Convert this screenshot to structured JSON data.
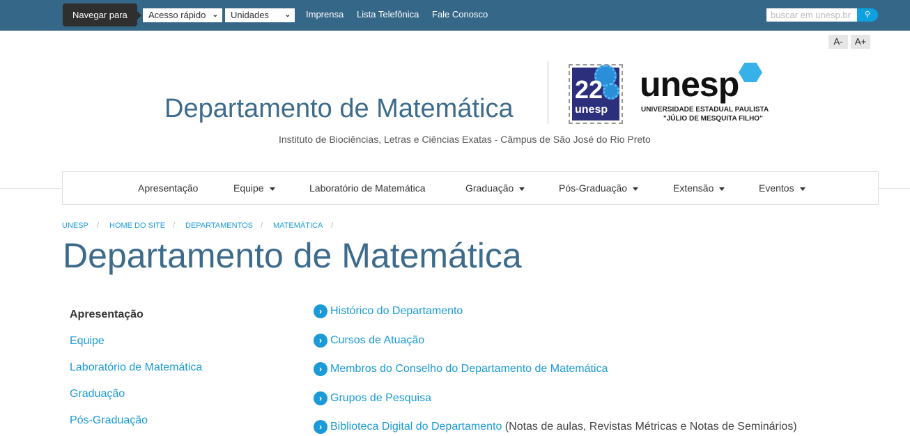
{
  "topbar": {
    "nav_for": "Navegar para",
    "quick_access": "Acesso rápido",
    "units": "Unidades",
    "links": [
      "Imprensa",
      "Lista Telefônica",
      "Fale Conosco"
    ],
    "search_placeholder": "buscar em unesp.br"
  },
  "font_controls": {
    "decrease": "A-",
    "increase": "A+"
  },
  "header": {
    "title": "Departamento de Matemática",
    "subtitle": "Instituto de Biociências, Letras e Ciências Exatas - Câmpus de São José do Rio Preto",
    "stamp_text": [
      "22",
      "unesp"
    ],
    "logo_word": "unesp",
    "logo_line1": "UNIVERSIDADE ESTADUAL PAULISTA",
    "logo_line2": "\"JÚLIO DE MESQUITA FILHO\""
  },
  "menu": [
    {
      "label": "Apresentação",
      "dropdown": false
    },
    {
      "label": "Equipe",
      "dropdown": true
    },
    {
      "label": "Laboratório de Matemática",
      "dropdown": false
    },
    {
      "label": "Graduação",
      "dropdown": true
    },
    {
      "label": "Pós-Graduação",
      "dropdown": true
    },
    {
      "label": "Extensão",
      "dropdown": true
    },
    {
      "label": "Eventos",
      "dropdown": true
    }
  ],
  "breadcrumb": [
    "UNESP",
    "HOME DO SITE",
    "DEPARTAMENTOS",
    "MATEMÁTICA"
  ],
  "page_title": "Departamento de Matemática",
  "sidebar": [
    "Apresentação",
    "Equipe",
    "Laboratório de Matemática",
    "Graduação",
    "Pós-Graduação"
  ],
  "links": [
    {
      "label": "Histórico do Departamento",
      "note": ""
    },
    {
      "label": "Cursos de Atuação",
      "note": ""
    },
    {
      "label": "Membros do Conselho do Departamento de Matemática",
      "note": ""
    },
    {
      "label": "Grupos de Pesquisa",
      "note": ""
    },
    {
      "label": "Biblioteca Digital do Departamento",
      "note": " (Notas de aulas, Revistas Métricas e Notas de Seminários)"
    }
  ],
  "colors": {
    "topbar": "#356789",
    "link": "#1a9bd7",
    "title": "#3d6b8c"
  }
}
